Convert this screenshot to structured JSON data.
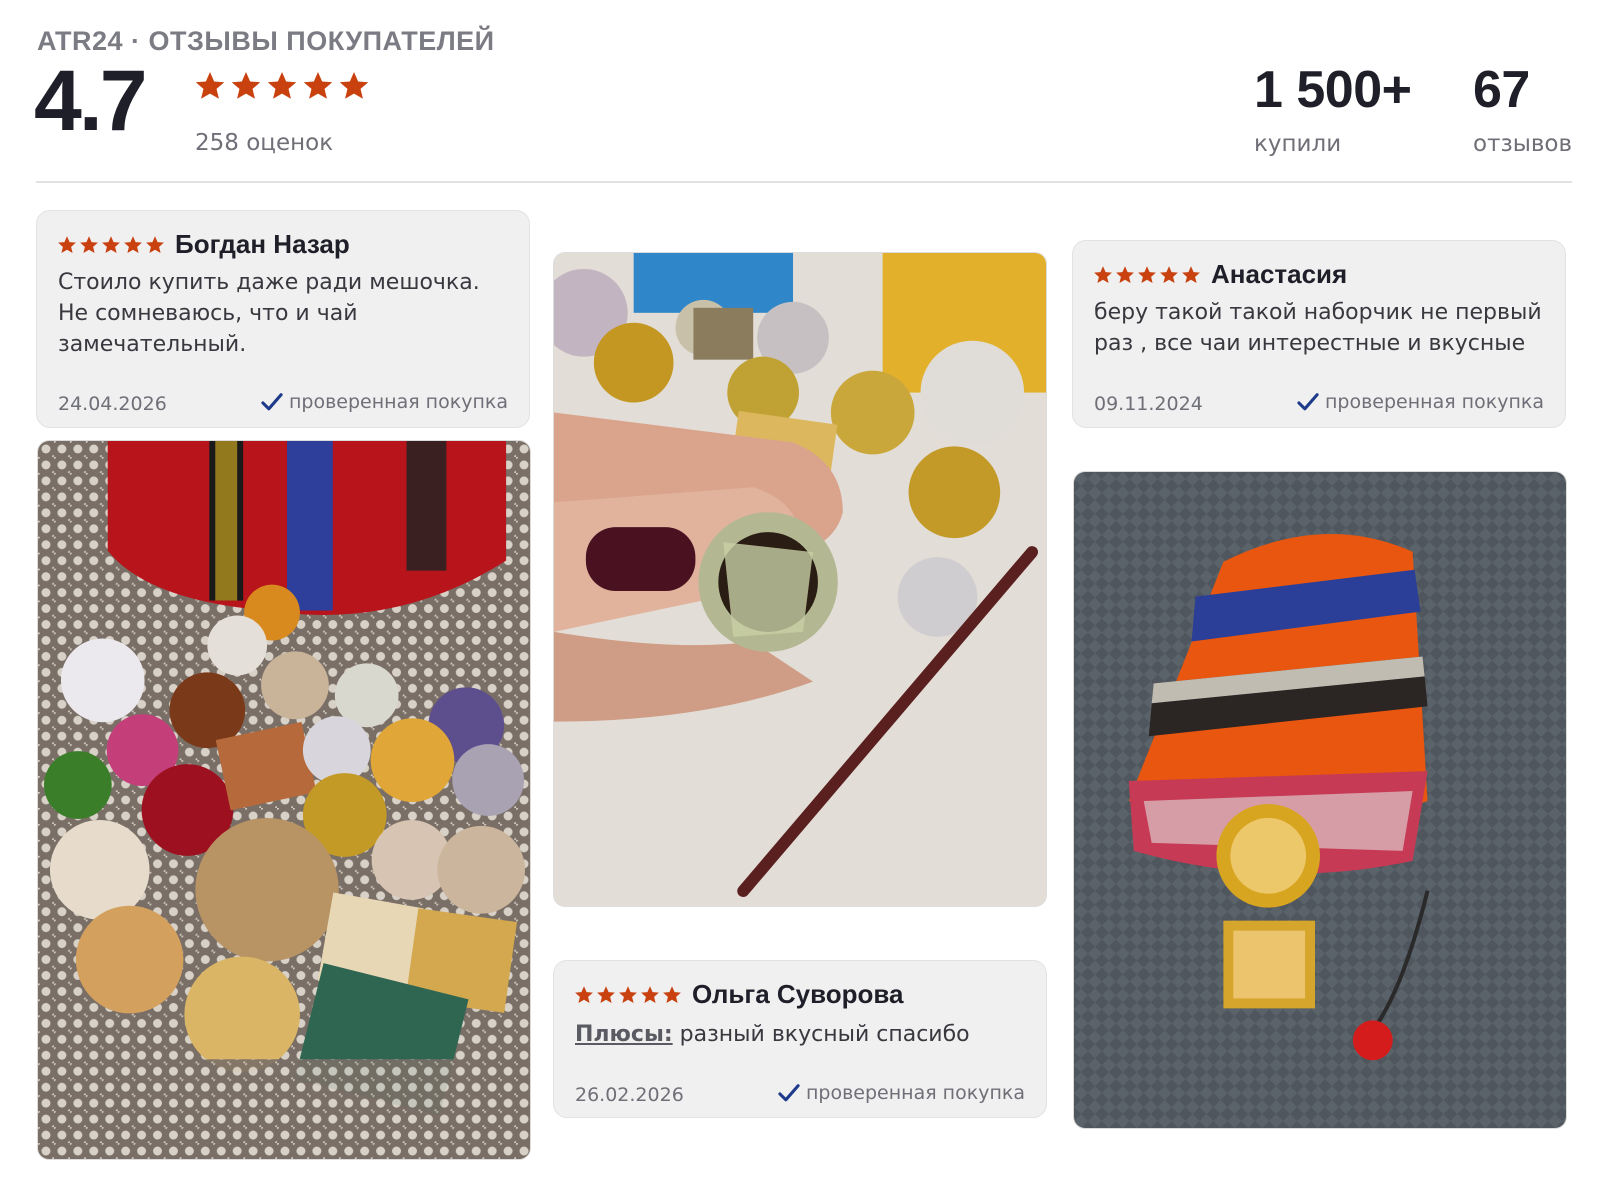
{
  "header": {
    "brand": "ATR24 · ОТЗЫВЫ ПОКУПАТЕЛЕЙ",
    "rating": "4.7",
    "ratings_count": "258 оценок",
    "stats": [
      {
        "value": "1 500+",
        "label": "купили"
      },
      {
        "value": "67",
        "label": "отзывов"
      }
    ]
  },
  "colors": {
    "star": "#c8410f",
    "check": "#1e3a8a",
    "card_bg": "#f0f0f0"
  },
  "icons": {
    "star": "star-icon",
    "check": "check-icon"
  },
  "reviews": [
    {
      "stars": 5,
      "name": "Богдан Назар",
      "text": "Стоило купить даже ради мешочка. Не сомневаюсь, что и чай замечательный.",
      "date": "24.04.2026",
      "verified": "проверенная покупка"
    },
    {
      "stars": 5,
      "name": "Анастасия",
      "text": "беру такой такой наборчик не первый раз , все чаи интерестные и вкусные",
      "date": "09.11.2024",
      "verified": "проверенная покупка"
    },
    {
      "stars": 5,
      "name": "Ольга Суворова",
      "pros_label": "Плюсы:",
      "text": " разный вкусный спасибо",
      "date": "26.02.2026",
      "verified": "проверенная покупка"
    }
  ]
}
